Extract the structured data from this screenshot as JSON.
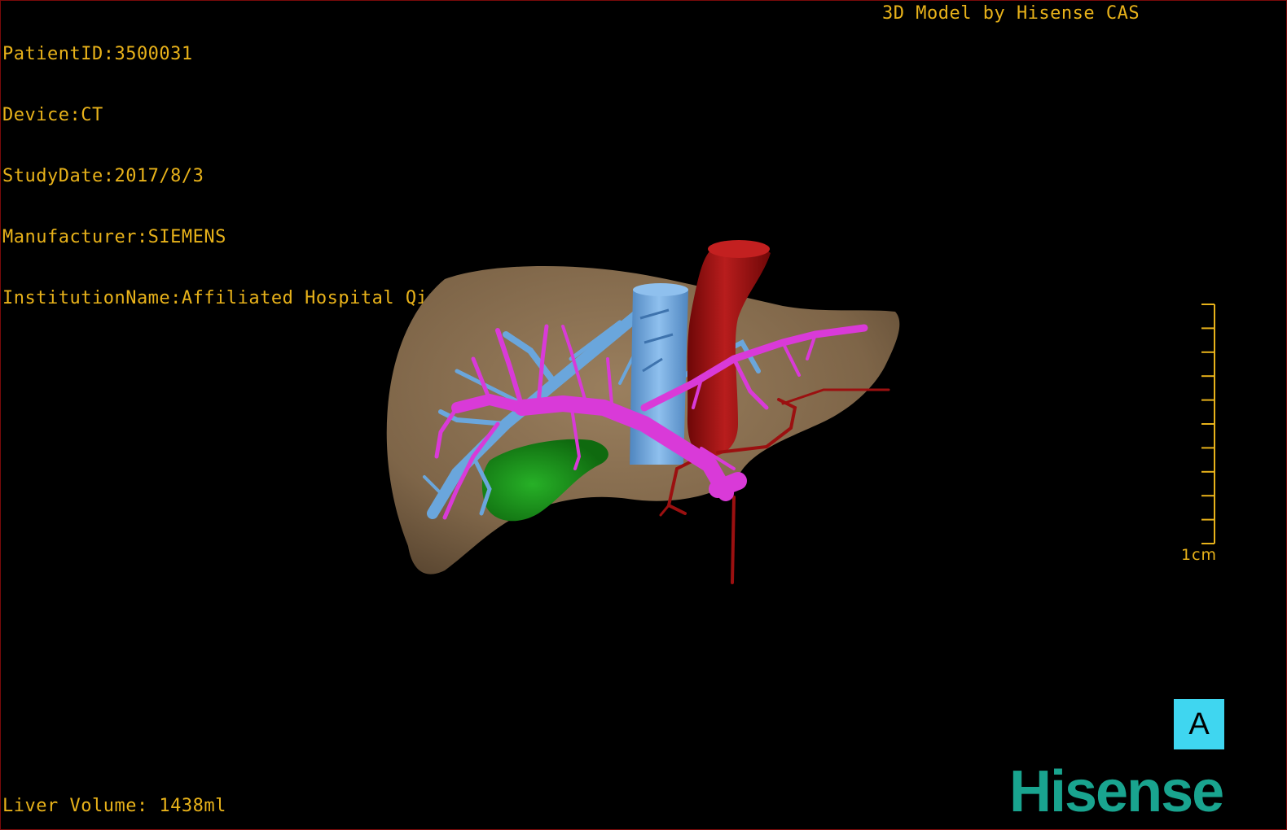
{
  "header": {
    "patient_id": "PatientID:3500031",
    "device": "Device:CT",
    "study_date": "StudyDate:2017/8/3",
    "manufacturer": "Manufacturer:SIEMENS",
    "institution": "InstitutionName:Affiliated Hospital Qingdao University-C",
    "credit": "3D Model by Hisense CAS"
  },
  "footer": {
    "liver_volume": "Liver Volume: 1438ml",
    "brand": "Hisense"
  },
  "scale_bar": {
    "label": "1cm",
    "ticks": 10
  },
  "orientation_marker": {
    "label": "A"
  },
  "colors": {
    "overlay_text": "#e8b21a",
    "liver": "#8c7354",
    "portal_vein": "#d93ad8",
    "hepatic_vein_ivc": "#6aa6dc",
    "aorta_artery": "#9b1010",
    "gallbladder": "#1a8c1a",
    "brand": "#19a48f",
    "orientation_bg": "#3fd6f0"
  }
}
